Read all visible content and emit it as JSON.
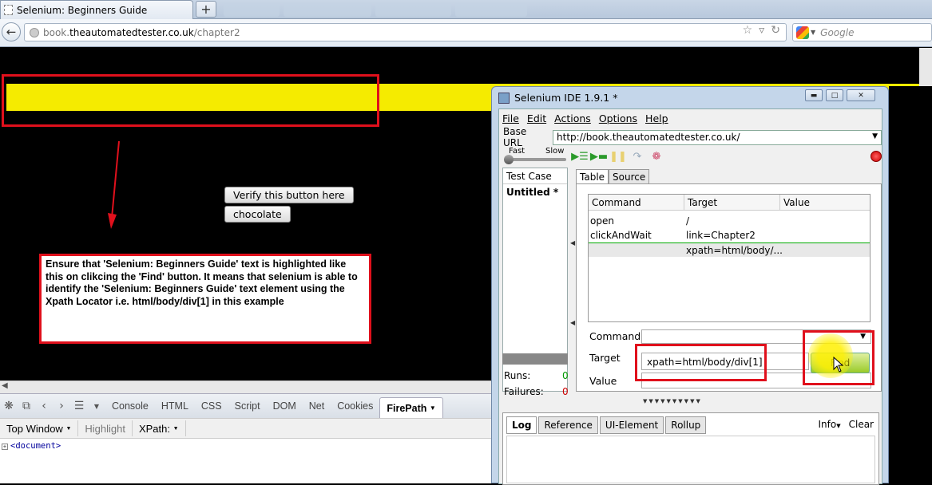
{
  "browser": {
    "tab_title": "Selenium: Beginners Guide",
    "new_tab_label": "+",
    "url_prefix": "book.",
    "url_domain": "theautomatedtester.co.uk",
    "url_path": "/chapter2",
    "search_placeholder": "Google"
  },
  "page": {
    "verify_button": "Verify this button here",
    "chocolate_button": "chocolate",
    "note_text": "Ensure that 'Selenium: Beginners Guide' text is highlighted like this on clikcing the 'Find' button. It means that selenium is able to identify the 'Selenium: Beginners Guide' text element using the Xpath Locator i.e. html/body/div[1] in this example"
  },
  "firebug": {
    "tabs": [
      "Console",
      "HTML",
      "CSS",
      "Script",
      "DOM",
      "Net",
      "Cookies",
      "FirePath"
    ],
    "sub": {
      "top_window": "Top Window",
      "highlight": "Highlight",
      "xpath": "XPath:"
    },
    "tree_root": "<document>"
  },
  "ide": {
    "title": "Selenium IDE 1.9.1 *",
    "menu": [
      "File",
      "Edit",
      "Actions",
      "Options",
      "Help"
    ],
    "base_url_label": "Base URL",
    "base_url_value": "http://book.theautomatedtester.co.uk/",
    "speed_fast": "Fast",
    "speed_slow": "Slow",
    "test_case_header": "Test Case",
    "test_case_item": "Untitled *",
    "runs_label": "Runs:",
    "runs_value": "0",
    "failures_label": "Failures:",
    "failures_value": "0",
    "tabs": [
      "Table",
      "Source"
    ],
    "table_headers": [
      "Command",
      "Target",
      "Value"
    ],
    "rows": [
      {
        "command": "open",
        "target": "/",
        "value": ""
      },
      {
        "command": "clickAndWait",
        "target": "link=Chapter2",
        "value": ""
      },
      {
        "command": "",
        "target": "xpath=html/body/...",
        "value": ""
      }
    ],
    "command_label": "Command",
    "target_label": "Target",
    "value_label": "Value",
    "target_value": "xpath=html/body/div[1]",
    "find_button": "Find",
    "log_tabs": [
      "Log",
      "Reference",
      "UI-Element",
      "Rollup"
    ],
    "info_label": "Info",
    "clear_label": "Clear"
  },
  "colors": {
    "highlight_yellow": "#f5eb00",
    "annotation_red": "#e0101c",
    "runs_green": "#009900",
    "failures_red": "#cc0000"
  }
}
